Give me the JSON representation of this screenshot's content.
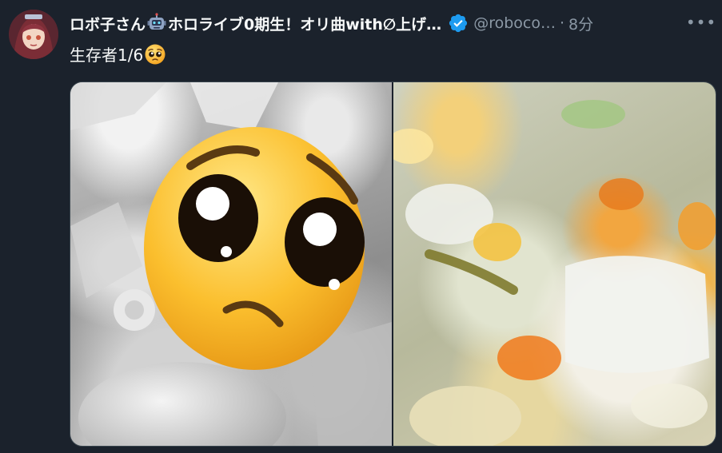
{
  "tweet": {
    "author_name": "ロボ子さん",
    "author_name_suffix": "ホロライブ0期生！オリ曲with∅上げ…",
    "handle": "@roboco…",
    "separator": "·",
    "time": "8分",
    "more_label": "•••",
    "text": "生存者1/6"
  },
  "icons": {
    "robot": "robot-emoji-icon",
    "verified": "verified-badge-icon",
    "pleading": "pleading-face-emoji-icon",
    "more": "more-options-icon"
  },
  "colors": {
    "background": "#1b222c",
    "text_primary": "#f7f9f9",
    "text_secondary": "#8b98a5",
    "verified": "#1d9bf0",
    "border": "#38444d"
  }
}
